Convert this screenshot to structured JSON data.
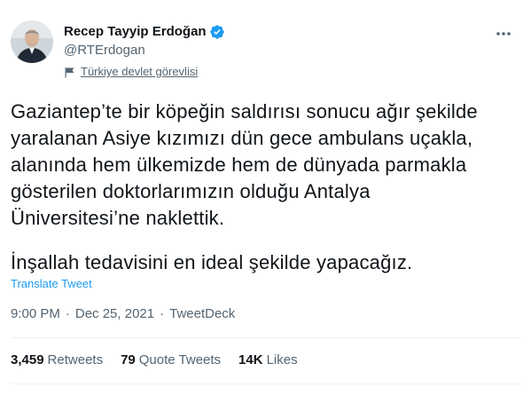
{
  "author": {
    "name": "Recep Tayyip Erdoğan",
    "handle": "@RTErdogan",
    "label": "Türkiye devlet görevlisi",
    "verified": true
  },
  "tweet": {
    "paragraphs": [
      "Gaziantep’te bir köpeğin saldırısı sonucu ağır şekilde\nyaralanan Asiye kızımızı dün gece ambulans uçakla,\nalanında hem ülkemizde hem de dünyada parmakla\ngösterilen doktorlarımızın olduğu Antalya\nÜniversitesi’ne naklettik.",
      "İnşallah tedavisini en ideal şekilde yapacağız."
    ],
    "translate_label": "Translate Tweet",
    "time": "9:00 PM",
    "date": "Dec 25, 2021",
    "source": "TweetDeck",
    "separator": "·"
  },
  "stats": {
    "retweets": {
      "count": "3,459",
      "label": "Retweets"
    },
    "quotes": {
      "count": "79",
      "label": "Quote Tweets"
    },
    "likes": {
      "count": "14K",
      "label": "Likes"
    }
  },
  "colors": {
    "accent": "#1d9bf0",
    "text": "#0f1419",
    "secondary": "#536471",
    "divider": "#eff3f4"
  }
}
